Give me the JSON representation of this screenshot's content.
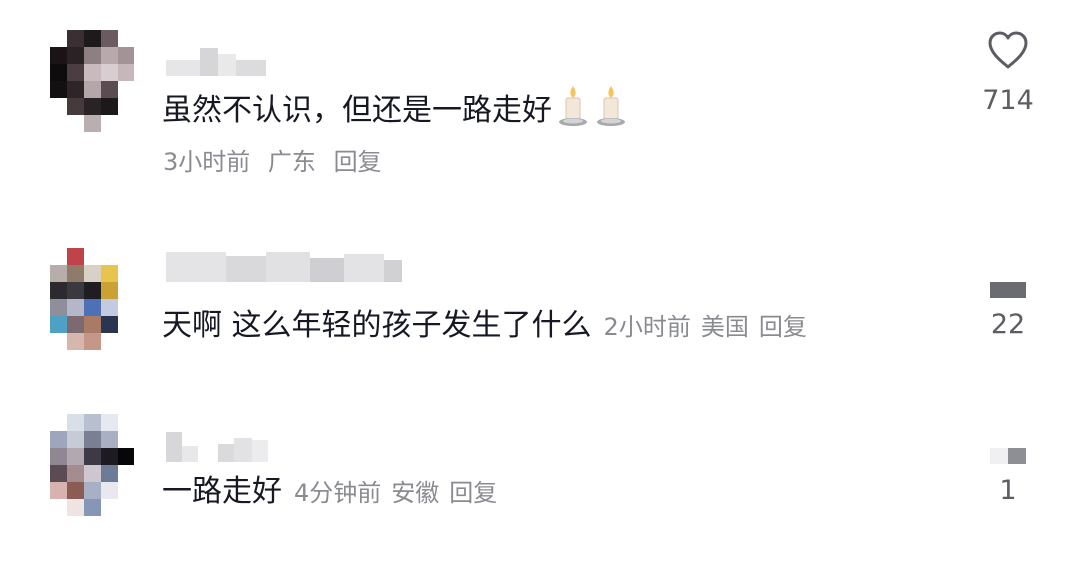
{
  "comments": [
    {
      "text": "虽然不认识，但还是一路走好",
      "emojis": [
        "candle-emoji",
        "candle-emoji"
      ],
      "time": "3小时前",
      "location": "广东",
      "reply_label": "回复",
      "likes": "714",
      "like_icon": "heart-outline-icon"
    },
    {
      "text": "天啊 这么年轻的孩子发生了什么",
      "time": "2小时前",
      "location": "美国",
      "reply_label": "回复",
      "likes": "22"
    },
    {
      "text": "一路走好",
      "time": "4分钟前",
      "location": "安徽",
      "reply_label": "回复",
      "likes": "1"
    }
  ],
  "colors": {
    "text_primary": "#161823",
    "text_secondary": "#8a8b91",
    "like_count": "#5c5d63"
  }
}
